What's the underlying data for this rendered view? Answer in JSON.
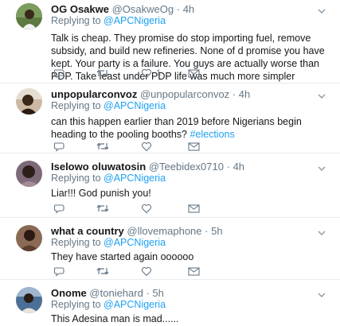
{
  "tweets": [
    {
      "name": "OG Osakwe",
      "handle": "@OsakweOg",
      "dot": "·",
      "time": "4h",
      "replying_prefix": "Replying to",
      "replying_to": "@APCNigeria",
      "text": "Talk is cheap. They promise do stop importing fuel, remove subsidy, and build new refineries. None of d promise you have kept. Your party is a failure. You guys are actually worse than PDP. Take least under PDP life was much more simpler",
      "like_count": "1"
    },
    {
      "name": "unpopularconvoz",
      "handle": "@unpopularconvoz",
      "dot": "·",
      "time": "4h",
      "replying_prefix": "Replying to",
      "replying_to": "@APCNigeria",
      "text": "can this happen earlier than 2019 before Nigerians begin heading to the pooling booths? ",
      "hashtag": "#elections",
      "like_count": ""
    },
    {
      "name": "Iselowo oluwatosin",
      "handle": "@Teebidex0710",
      "dot": "·",
      "time": "4h",
      "replying_prefix": "Replying to",
      "replying_to": "@APCNigeria",
      "text": "Liar!!! God punish you!",
      "like_count": ""
    },
    {
      "name": "what a country",
      "handle": "@llovemaphone",
      "dot": "·",
      "time": "5h",
      "replying_prefix": "Replying to",
      "replying_to": "@APCNigeria",
      "text": "They have started again oooooo",
      "like_count": ""
    },
    {
      "name": "Onome",
      "handle": "@toniehard",
      "dot": "·",
      "time": "5h",
      "replying_prefix": "Replying to",
      "replying_to": "@APCNigeria",
      "text": "This Adesina man is mad......",
      "like_count": ""
    }
  ],
  "icons": {
    "reply": "reply-icon",
    "retweet": "retweet-icon",
    "like": "like-icon",
    "message": "direct-message-icon",
    "more": "chevron-down-icon"
  },
  "colors": {
    "link": "#1da1f2",
    "secondary_text": "#657786",
    "divider": "#e6ecf0"
  }
}
